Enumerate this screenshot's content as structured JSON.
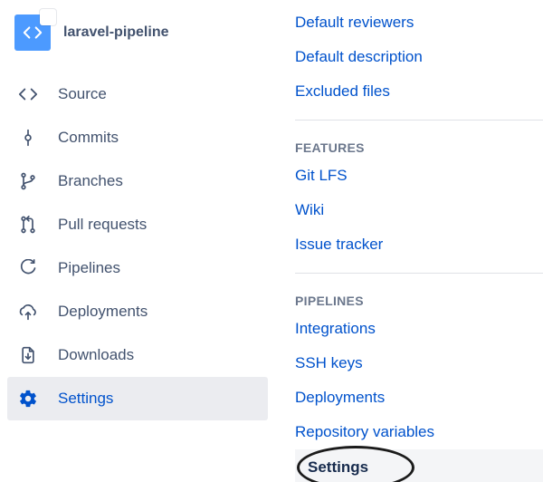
{
  "repo": {
    "title": "laravel-pipeline"
  },
  "nav": {
    "source": {
      "label": "Source"
    },
    "commits": {
      "label": "Commits"
    },
    "branches": {
      "label": "Branches"
    },
    "pullRequests": {
      "label": "Pull requests"
    },
    "pipelines": {
      "label": "Pipelines"
    },
    "deployments": {
      "label": "Deployments"
    },
    "downloads": {
      "label": "Downloads"
    },
    "settings": {
      "label": "Settings"
    }
  },
  "panel": {
    "topLinks": {
      "defaultReviewers": "Default reviewers",
      "defaultDescription": "Default description",
      "excludedFiles": "Excluded files"
    },
    "features": {
      "heading": "FEATURES",
      "gitLfs": "Git LFS",
      "wiki": "Wiki",
      "issueTracker": "Issue tracker"
    },
    "pipelines": {
      "heading": "PIPELINES",
      "integrations": "Integrations",
      "sshKeys": "SSH keys",
      "deployments": "Deployments",
      "repositoryVariables": "Repository variables",
      "settings": "Settings"
    }
  }
}
